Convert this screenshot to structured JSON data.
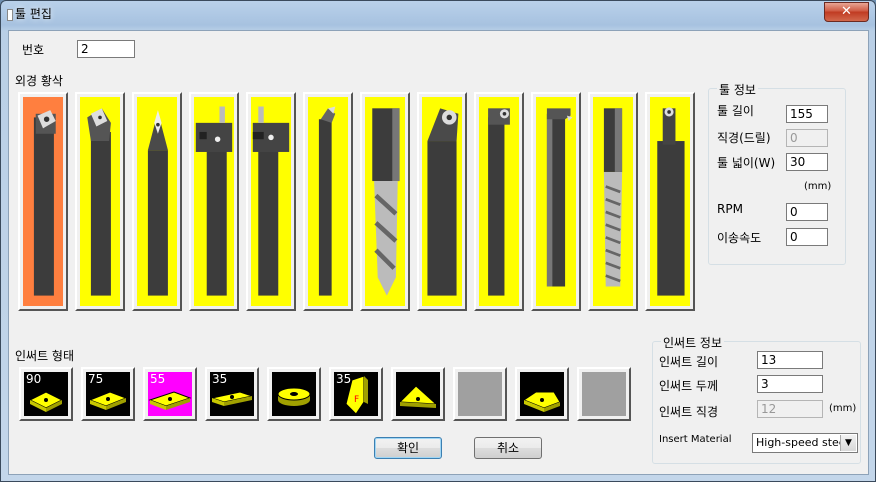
{
  "window": {
    "title": "툴 편집",
    "close_label": "✕"
  },
  "number": {
    "label": "번호",
    "value": "2"
  },
  "tool_group_label": "외경 황삭",
  "tools": [
    {
      "icon": "turning-tool-square-insert-icon",
      "selected": true
    },
    {
      "icon": "turning-tool-rhombic-insert-icon",
      "selected": false
    },
    {
      "icon": "turning-tool-diamond-insert-icon",
      "selected": false
    },
    {
      "icon": "grooving-tool-left-icon",
      "selected": false
    },
    {
      "icon": "grooving-tool-right-icon",
      "selected": false
    },
    {
      "icon": "boring-bar-icon",
      "selected": false
    },
    {
      "icon": "twist-drill-icon",
      "selected": false
    },
    {
      "icon": "round-insert-tool-icon",
      "selected": false
    },
    {
      "icon": "internal-boring-bar-icon",
      "selected": false
    },
    {
      "icon": "threading-tool-icon",
      "selected": false
    },
    {
      "icon": "tap-icon",
      "selected": false
    },
    {
      "icon": "button-insert-boring-bar-icon",
      "selected": false
    }
  ],
  "tool_info": {
    "title": "툴 정보",
    "length_label": "툴 길이",
    "length_value": "155",
    "diameter_label": "직경(드릴)",
    "diameter_value": "0",
    "width_label": "툴 넓이(W)",
    "width_value": "30",
    "unit": "(mm)",
    "rpm_label": "RPM",
    "rpm_value": "0",
    "feed_label": "이송속도",
    "feed_value": "0"
  },
  "insert_shape_label": "인써트 형태",
  "inserts": [
    {
      "angle": "90",
      "icon": "square-insert-90-icon",
      "selected": false
    },
    {
      "angle": "75",
      "icon": "rhombic-insert-75-icon",
      "selected": false
    },
    {
      "angle": "55",
      "icon": "rhombic-insert-55-icon",
      "selected": true
    },
    {
      "angle": "35",
      "icon": "rhombic-insert-35-icon",
      "selected": false
    },
    {
      "angle": "",
      "icon": "round-insert-icon",
      "selected": false
    },
    {
      "angle": "35",
      "icon": "threading-insert-icon",
      "selected": false
    },
    {
      "angle": "",
      "icon": "triangle-insert-icon",
      "selected": false
    },
    {
      "angle": "",
      "icon": "empty-insert-slot-icon",
      "selected": false
    },
    {
      "angle": "",
      "icon": "trigon-insert-icon",
      "selected": false
    },
    {
      "angle": "",
      "icon": "empty-insert-slot-icon",
      "selected": false
    }
  ],
  "insert_info": {
    "title": "인써트 정보",
    "length_label": "인써트 길이",
    "length_value": "13",
    "thickness_label": "인써트 두께",
    "thickness_value": "3",
    "diameter_label": "인써트 직경",
    "diameter_value": "12",
    "unit": "(mm)",
    "material_label": "Insert Material",
    "material_value": "High-speed steel"
  },
  "buttons": {
    "ok": "확인",
    "cancel": "취소"
  },
  "colors": {
    "tool_bg": "#ffff00",
    "tool_selected": "#ff7f3f",
    "insert_selected": "#ff00ff",
    "insert_bg": "#000000"
  }
}
